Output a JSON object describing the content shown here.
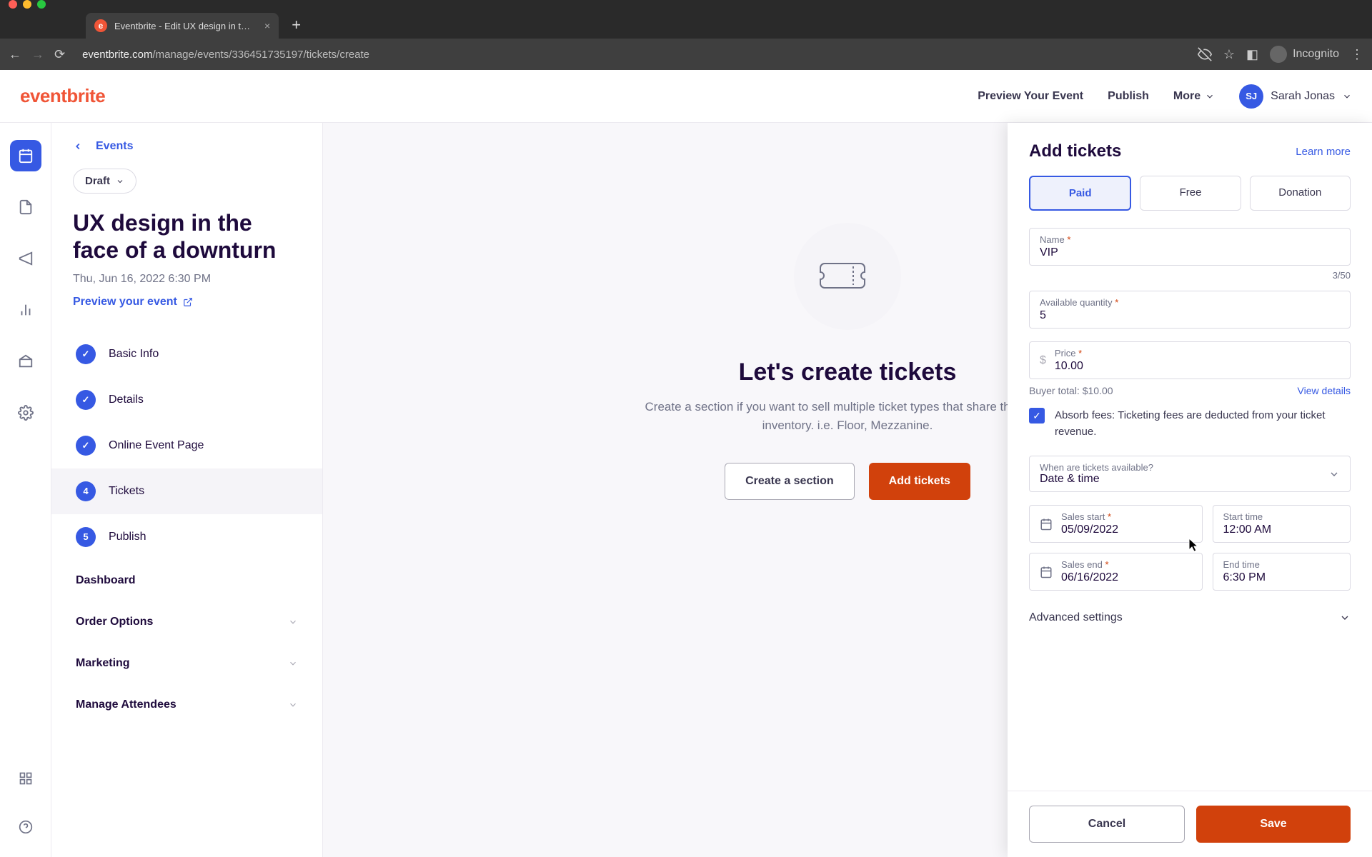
{
  "browser": {
    "tab_title": "Eventbrite - Edit UX design in t…",
    "url_host": "eventbrite.com",
    "url_path": "/manage/events/336451735197/tickets/create",
    "incognito_label": "Incognito"
  },
  "header": {
    "logo": "eventbrite",
    "preview": "Preview Your Event",
    "publish": "Publish",
    "more": "More",
    "user_initials": "SJ",
    "user_name": "Sarah Jonas"
  },
  "sidebar": {
    "back_label": "Events",
    "status": "Draft",
    "event_title": "UX design in the face of a downturn",
    "event_date": "Thu, Jun 16, 2022 6:30 PM",
    "preview_link": "Preview your event",
    "steps": [
      {
        "label": "Basic Info",
        "done": true
      },
      {
        "label": "Details",
        "done": true
      },
      {
        "label": "Online Event Page",
        "done": true
      },
      {
        "label": "Tickets",
        "num": "4",
        "current": true
      },
      {
        "label": "Publish",
        "num": "5"
      }
    ],
    "sections": [
      "Dashboard",
      "Order Options",
      "Marketing",
      "Manage Attendees"
    ]
  },
  "main": {
    "title": "Let's create tickets",
    "subtitle": "Create a section if you want to sell multiple ticket types that share the same inventory. i.e. Floor, Mezzanine.",
    "create_section": "Create a section",
    "add_tickets": "Add tickets"
  },
  "drawer": {
    "title": "Add tickets",
    "learn_more": "Learn more",
    "types": {
      "paid": "Paid",
      "free": "Free",
      "donation": "Donation"
    },
    "name_label": "Name",
    "name_value": "VIP",
    "name_counter": "3/50",
    "qty_label": "Available quantity",
    "qty_value": "5",
    "price_label": "Price",
    "price_value": "10.00",
    "currency": "$",
    "buyer_total": "Buyer total: $10.00",
    "view_details": "View details",
    "absorb_label": "Absorb fees: Ticketing fees are deducted from your ticket revenue.",
    "availability_label": "When are tickets available?",
    "availability_value": "Date & time",
    "sales_start_label": "Sales start",
    "sales_start_value": "05/09/2022",
    "start_time_label": "Start time",
    "start_time_value": "12:00 AM",
    "sales_end_label": "Sales end",
    "sales_end_value": "06/16/2022",
    "end_time_label": "End time",
    "end_time_value": "6:30 PM",
    "advanced": "Advanced settings",
    "cancel": "Cancel",
    "save": "Save"
  }
}
